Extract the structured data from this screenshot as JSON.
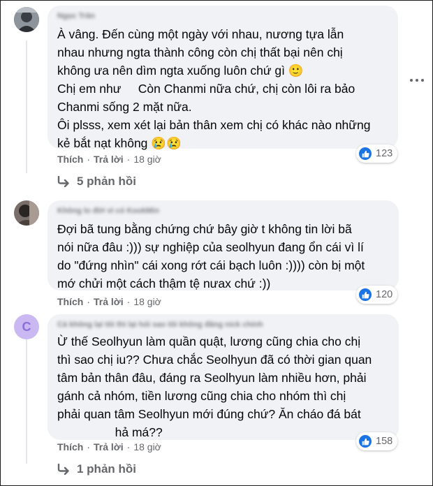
{
  "comments": [
    {
      "author": "Ngọc Trân",
      "lines": [
        "À vâng. Đến cùng một ngày với nhau, nương tựa lẫn",
        "nhau nhưng ngta thành công còn chị thất bại nên chị",
        "không ưa nên dìm ngta xuống luôn chứ gì 🙂",
        "Chị em như     Còn Chanmi nữa chứ, chị còn lôi ra bảo",
        "Chanmi sống 2 mặt nữa.",
        "Ôi plsss, xem xét lại bản thân xem chị có khác nào những",
        "kẻ bắt nạt không 😢😢"
      ],
      "like_label": "Thích",
      "reply_label": "Trả lời",
      "time": "18 giờ",
      "reaction_count": "123",
      "replies_label": "5 phản hồi"
    },
    {
      "author": "Không lo đời vì có KookMin",
      "lines": [
        "Đợi bã tung bằng chứng chứ bây giờ t không tin lời bã",
        "nói nữa đâu :))) sự nghiệp của seolhyun đang ổn cái vì lí",
        "do \"đứng nhìn\" cái xong rớt cái bạch luôn :)))) còn bị một",
        "mớ chửi một cách thậm tệ nưax chứ :))"
      ],
      "like_label": "Thích",
      "reply_label": "Trả lời",
      "time": "18 giờ",
      "reaction_count": "120"
    },
    {
      "author": "Cả không lại tôi thì lại hỏi sao tôi không đăng nick chính",
      "avatar_letter": "C",
      "lines": [
        "Ừ thế Seolhyun làm quần quật, lương cũng chia cho chị",
        "thì sao chị iu?? Chưa chắc Seolhyun đã có thời gian quan",
        "tâm bản thân đâu, đáng ra Seolhyun làm nhiều hơn, phải",
        "gánh cả nhóm, tiền lương cũng chia cho nhóm thì chị",
        "phải quan tâm Seolhyun mới đúng chứ? Ăn cháo đá bát",
        "                 hả má??"
      ],
      "like_label": "Thích",
      "reply_label": "Trả lời",
      "time": "18 giờ",
      "reaction_count": "158",
      "replies_label": "1 phản hồi"
    }
  ],
  "colors": {
    "bubble": "#f0f2f5",
    "like_blue": "#1b74e4",
    "meta_gray": "#65676b",
    "avatar_c": "#c9b8f2",
    "avatar_c_letter": "#8a6fd6"
  },
  "icons": [
    "avatar-photo",
    "like-icon",
    "more-options-icon",
    "reply-arrow-icon"
  ]
}
